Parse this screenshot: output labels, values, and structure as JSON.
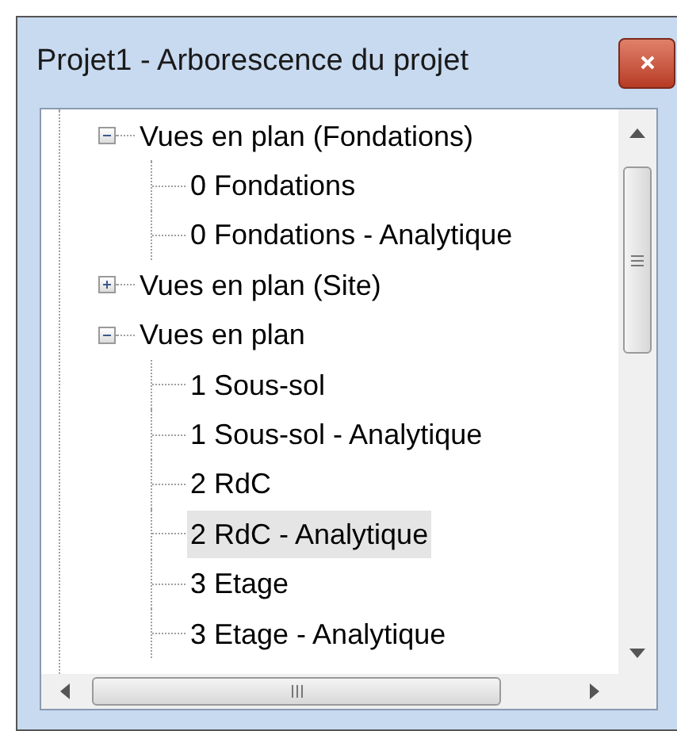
{
  "window": {
    "title": "Projet1 - Arborescence du projet"
  },
  "tree": [
    {
      "label": "Vues en plan (Fondations)",
      "expanded": true,
      "selected": false,
      "children": [
        {
          "label": "0 Fondations",
          "selected": false
        },
        {
          "label": "0 Fondations - Analytique",
          "selected": false
        }
      ]
    },
    {
      "label": "Vues en plan (Site)",
      "expanded": false,
      "selected": false
    },
    {
      "label": "Vues en plan",
      "expanded": true,
      "selected": false,
      "children": [
        {
          "label": "1 Sous-sol",
          "selected": false
        },
        {
          "label": "1 Sous-sol - Analytique",
          "selected": false
        },
        {
          "label": "2 RdC",
          "selected": false
        },
        {
          "label": "2 RdC - Analytique",
          "selected": true
        },
        {
          "label": "3 Etage",
          "selected": false
        },
        {
          "label": "3 Etage - Analytique",
          "selected": false
        }
      ]
    }
  ]
}
